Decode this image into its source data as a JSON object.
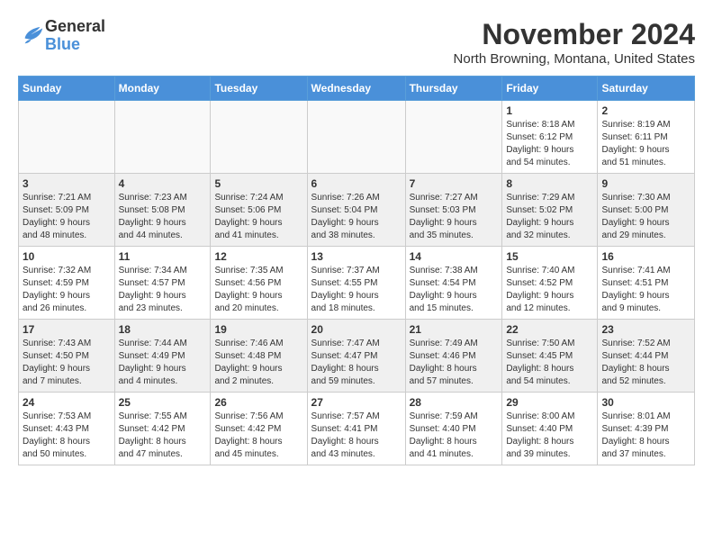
{
  "logo": {
    "general": "General",
    "blue": "Blue"
  },
  "title": "November 2024",
  "location": "North Browning, Montana, United States",
  "days_of_week": [
    "Sunday",
    "Monday",
    "Tuesday",
    "Wednesday",
    "Thursday",
    "Friday",
    "Saturday"
  ],
  "weeks": [
    {
      "shaded": false,
      "days": [
        {
          "num": "",
          "info": ""
        },
        {
          "num": "",
          "info": ""
        },
        {
          "num": "",
          "info": ""
        },
        {
          "num": "",
          "info": ""
        },
        {
          "num": "",
          "info": ""
        },
        {
          "num": "1",
          "info": "Sunrise: 8:18 AM\nSunset: 6:12 PM\nDaylight: 9 hours\nand 54 minutes."
        },
        {
          "num": "2",
          "info": "Sunrise: 8:19 AM\nSunset: 6:11 PM\nDaylight: 9 hours\nand 51 minutes."
        }
      ]
    },
    {
      "shaded": true,
      "days": [
        {
          "num": "3",
          "info": "Sunrise: 7:21 AM\nSunset: 5:09 PM\nDaylight: 9 hours\nand 48 minutes."
        },
        {
          "num": "4",
          "info": "Sunrise: 7:23 AM\nSunset: 5:08 PM\nDaylight: 9 hours\nand 44 minutes."
        },
        {
          "num": "5",
          "info": "Sunrise: 7:24 AM\nSunset: 5:06 PM\nDaylight: 9 hours\nand 41 minutes."
        },
        {
          "num": "6",
          "info": "Sunrise: 7:26 AM\nSunset: 5:04 PM\nDaylight: 9 hours\nand 38 minutes."
        },
        {
          "num": "7",
          "info": "Sunrise: 7:27 AM\nSunset: 5:03 PM\nDaylight: 9 hours\nand 35 minutes."
        },
        {
          "num": "8",
          "info": "Sunrise: 7:29 AM\nSunset: 5:02 PM\nDaylight: 9 hours\nand 32 minutes."
        },
        {
          "num": "9",
          "info": "Sunrise: 7:30 AM\nSunset: 5:00 PM\nDaylight: 9 hours\nand 29 minutes."
        }
      ]
    },
    {
      "shaded": false,
      "days": [
        {
          "num": "10",
          "info": "Sunrise: 7:32 AM\nSunset: 4:59 PM\nDaylight: 9 hours\nand 26 minutes."
        },
        {
          "num": "11",
          "info": "Sunrise: 7:34 AM\nSunset: 4:57 PM\nDaylight: 9 hours\nand 23 minutes."
        },
        {
          "num": "12",
          "info": "Sunrise: 7:35 AM\nSunset: 4:56 PM\nDaylight: 9 hours\nand 20 minutes."
        },
        {
          "num": "13",
          "info": "Sunrise: 7:37 AM\nSunset: 4:55 PM\nDaylight: 9 hours\nand 18 minutes."
        },
        {
          "num": "14",
          "info": "Sunrise: 7:38 AM\nSunset: 4:54 PM\nDaylight: 9 hours\nand 15 minutes."
        },
        {
          "num": "15",
          "info": "Sunrise: 7:40 AM\nSunset: 4:52 PM\nDaylight: 9 hours\nand 12 minutes."
        },
        {
          "num": "16",
          "info": "Sunrise: 7:41 AM\nSunset: 4:51 PM\nDaylight: 9 hours\nand 9 minutes."
        }
      ]
    },
    {
      "shaded": true,
      "days": [
        {
          "num": "17",
          "info": "Sunrise: 7:43 AM\nSunset: 4:50 PM\nDaylight: 9 hours\nand 7 minutes."
        },
        {
          "num": "18",
          "info": "Sunrise: 7:44 AM\nSunset: 4:49 PM\nDaylight: 9 hours\nand 4 minutes."
        },
        {
          "num": "19",
          "info": "Sunrise: 7:46 AM\nSunset: 4:48 PM\nDaylight: 9 hours\nand 2 minutes."
        },
        {
          "num": "20",
          "info": "Sunrise: 7:47 AM\nSunset: 4:47 PM\nDaylight: 8 hours\nand 59 minutes."
        },
        {
          "num": "21",
          "info": "Sunrise: 7:49 AM\nSunset: 4:46 PM\nDaylight: 8 hours\nand 57 minutes."
        },
        {
          "num": "22",
          "info": "Sunrise: 7:50 AM\nSunset: 4:45 PM\nDaylight: 8 hours\nand 54 minutes."
        },
        {
          "num": "23",
          "info": "Sunrise: 7:52 AM\nSunset: 4:44 PM\nDaylight: 8 hours\nand 52 minutes."
        }
      ]
    },
    {
      "shaded": false,
      "days": [
        {
          "num": "24",
          "info": "Sunrise: 7:53 AM\nSunset: 4:43 PM\nDaylight: 8 hours\nand 50 minutes."
        },
        {
          "num": "25",
          "info": "Sunrise: 7:55 AM\nSunset: 4:42 PM\nDaylight: 8 hours\nand 47 minutes."
        },
        {
          "num": "26",
          "info": "Sunrise: 7:56 AM\nSunset: 4:42 PM\nDaylight: 8 hours\nand 45 minutes."
        },
        {
          "num": "27",
          "info": "Sunrise: 7:57 AM\nSunset: 4:41 PM\nDaylight: 8 hours\nand 43 minutes."
        },
        {
          "num": "28",
          "info": "Sunrise: 7:59 AM\nSunset: 4:40 PM\nDaylight: 8 hours\nand 41 minutes."
        },
        {
          "num": "29",
          "info": "Sunrise: 8:00 AM\nSunset: 4:40 PM\nDaylight: 8 hours\nand 39 minutes."
        },
        {
          "num": "30",
          "info": "Sunrise: 8:01 AM\nSunset: 4:39 PM\nDaylight: 8 hours\nand 37 minutes."
        }
      ]
    }
  ]
}
